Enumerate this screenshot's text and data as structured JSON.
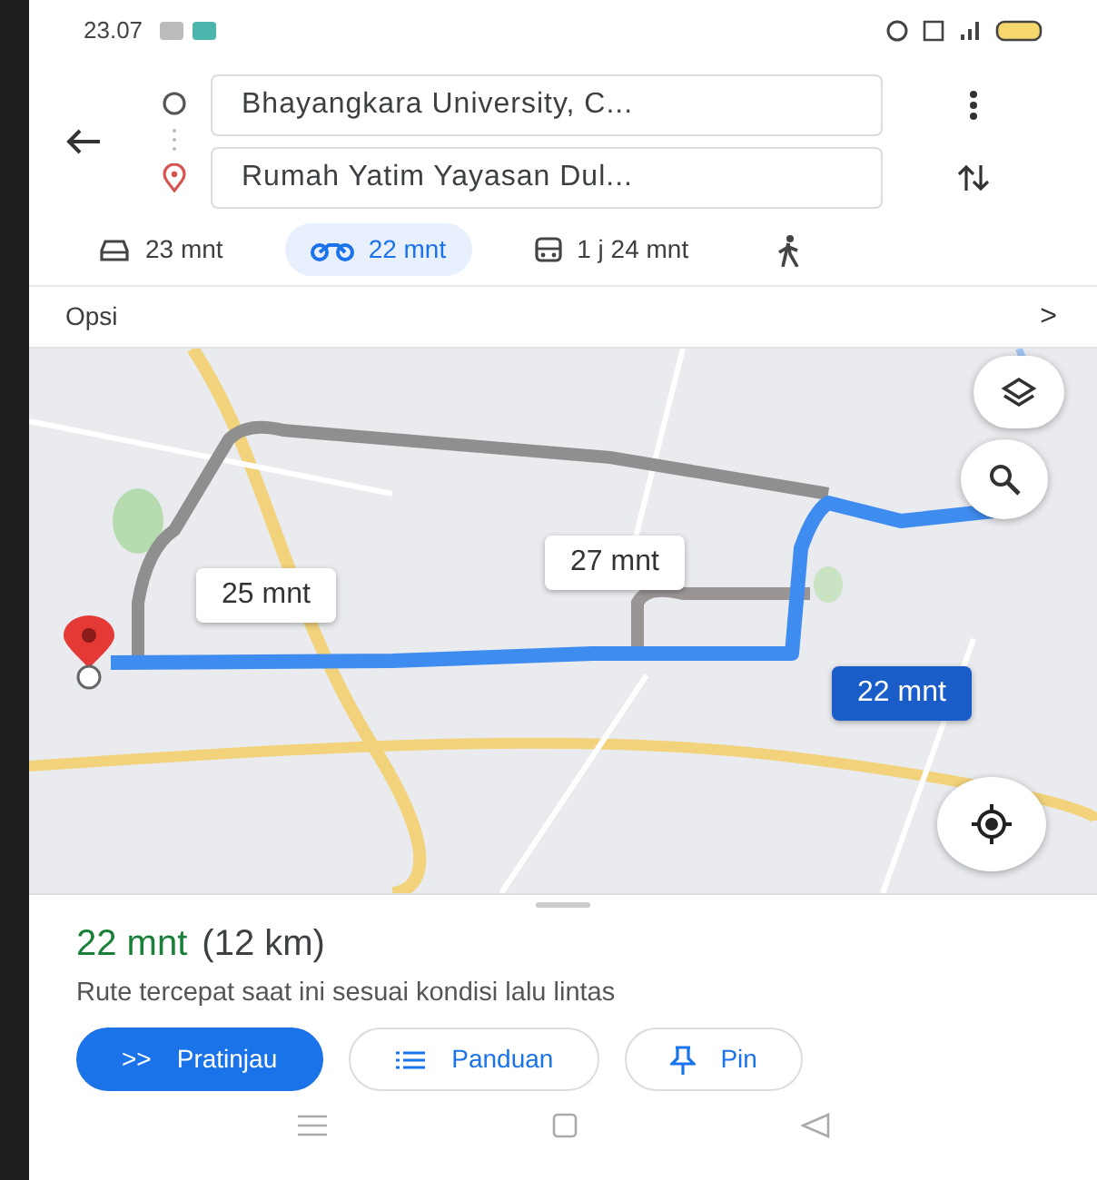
{
  "status_bar": {
    "time": "23.07"
  },
  "route": {
    "origin": "Bhayangkara University, C...",
    "destination": "Rumah Yatim Yayasan Dul..."
  },
  "modes": [
    {
      "kind": "car",
      "label": "23 mnt",
      "selected": false
    },
    {
      "kind": "motorbike",
      "label": "22 mnt",
      "selected": true
    },
    {
      "kind": "transit",
      "label": "1 j 24 mnt",
      "selected": false
    },
    {
      "kind": "walk",
      "selected": false
    }
  ],
  "options": {
    "label": "Opsi",
    "chevron": ">"
  },
  "map": {
    "route_labels": [
      {
        "text": "25 mnt",
        "selected": false
      },
      {
        "text": "27 mnt",
        "selected": false
      },
      {
        "text": "22 mnt",
        "selected": true
      }
    ]
  },
  "summary": {
    "duration": "22 mnt",
    "distance": "(12 km)",
    "description": "Rute tercepat saat ini sesuai kondisi lalu lintas"
  },
  "actions": [
    {
      "kind": "preview",
      "icon": ">>",
      "label": "Pratinjau",
      "primary": true
    },
    {
      "kind": "steps",
      "label": "Panduan",
      "primary": false
    },
    {
      "kind": "pin",
      "label": "Pin",
      "primary": false
    }
  ]
}
